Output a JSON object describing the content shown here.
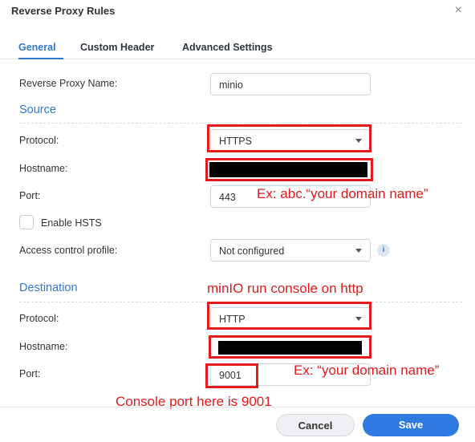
{
  "window": {
    "title": "Reverse Proxy Rules",
    "close_glyph": "×"
  },
  "tabs": [
    {
      "label": "General",
      "active": true
    },
    {
      "label": "Custom Header",
      "active": false
    },
    {
      "label": "Advanced Settings",
      "active": false
    }
  ],
  "general": {
    "name_label": "Reverse Proxy Name:",
    "name_value": "minio"
  },
  "source": {
    "title": "Source",
    "protocol_label": "Protocol:",
    "protocol_value": "HTTPS",
    "hostname_label": "Hostname:",
    "port_label": "Port:",
    "port_value": "443",
    "hsts_label": "Enable HSTS",
    "hsts_checked": false,
    "acp_label": "Access control profile:",
    "acp_value": "Not configured"
  },
  "destination": {
    "title": "Destination",
    "protocol_label": "Protocol:",
    "protocol_value": "HTTP",
    "hostname_label": "Hostname:",
    "port_label": "Port:",
    "port_value": "9001"
  },
  "annotations": {
    "source_hostname": "Ex: abc.“your domain name”",
    "minio_console": "minIO run console on http",
    "destination_hostname": "Ex: “your domain name”",
    "console_port": "Console port here is 9001"
  },
  "footer": {
    "cancel_label": "Cancel",
    "save_label": "Save"
  },
  "colors": {
    "accent": "#2f7ad6",
    "annotation": "#e21a1a",
    "save_button": "#2e7ae0"
  },
  "icons": {
    "close": "close-icon",
    "caret": "chevron-down-icon",
    "info": "info-icon"
  }
}
